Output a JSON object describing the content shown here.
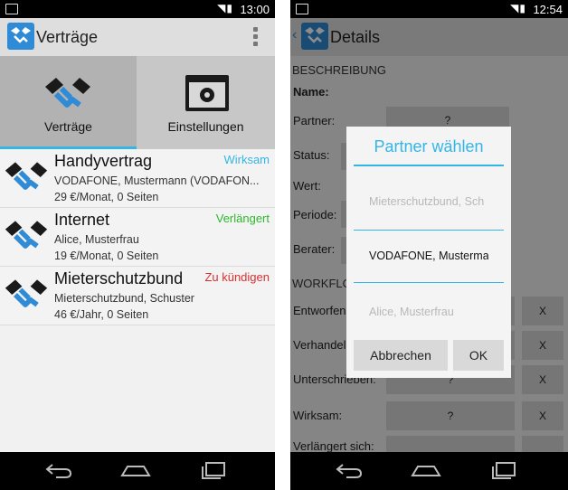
{
  "left": {
    "status_time": "13:00",
    "app_title": "Verträge",
    "tabs": [
      {
        "label": "Verträge",
        "icon": "handshake-icon"
      },
      {
        "label": "Einstellungen",
        "icon": "settings-window-icon"
      }
    ],
    "items": [
      {
        "title": "Handyvertrag",
        "subtitle": "VODAFONE, Mustermann (VODAFON...",
        "meta": "29 €/Monat, 0 Seiten",
        "status": "Wirksam",
        "status_color": "#33b5e5"
      },
      {
        "title": "Internet",
        "subtitle": "Alice, Musterfrau",
        "meta": "19 €/Monat, 0 Seiten",
        "status": "Verlängert",
        "status_color": "#2db82d"
      },
      {
        "title": "Mieterschutzbund",
        "subtitle": "Mieterschutzbund, Schuster",
        "meta": "46 €/Jahr, 0 Seiten",
        "status": "Zu kündigen",
        "status_color": "#d83030"
      }
    ]
  },
  "right": {
    "status_time": "12:54",
    "app_title": "Details",
    "section_description": "BESCHREIBUNG",
    "section_workflow": "WORKFLO",
    "labels": {
      "name": "Name:",
      "partner": "Partner:",
      "status": "Status:",
      "wert": "Wert:",
      "periode": "Periode:",
      "berater": "Berater:",
      "entworfen": "Entworfen",
      "verhandelt": "Verhandel",
      "unterschrieben": "Unterschrieben:",
      "wirksam": "Wirksam:",
      "verlaengert": "Verlängert sich:"
    },
    "question_mark": "?",
    "x_mark": "X",
    "dialog": {
      "title": "Partner wählen",
      "options": [
        "Mieterschutzbund, Sch",
        "VODAFONE, Musterma",
        "Alice, Musterfrau"
      ],
      "cancel_label": "Abbrechen",
      "ok_label": "OK"
    }
  },
  "colors": {
    "accent": "#33b5e5",
    "logo": "#2f8bd6"
  }
}
